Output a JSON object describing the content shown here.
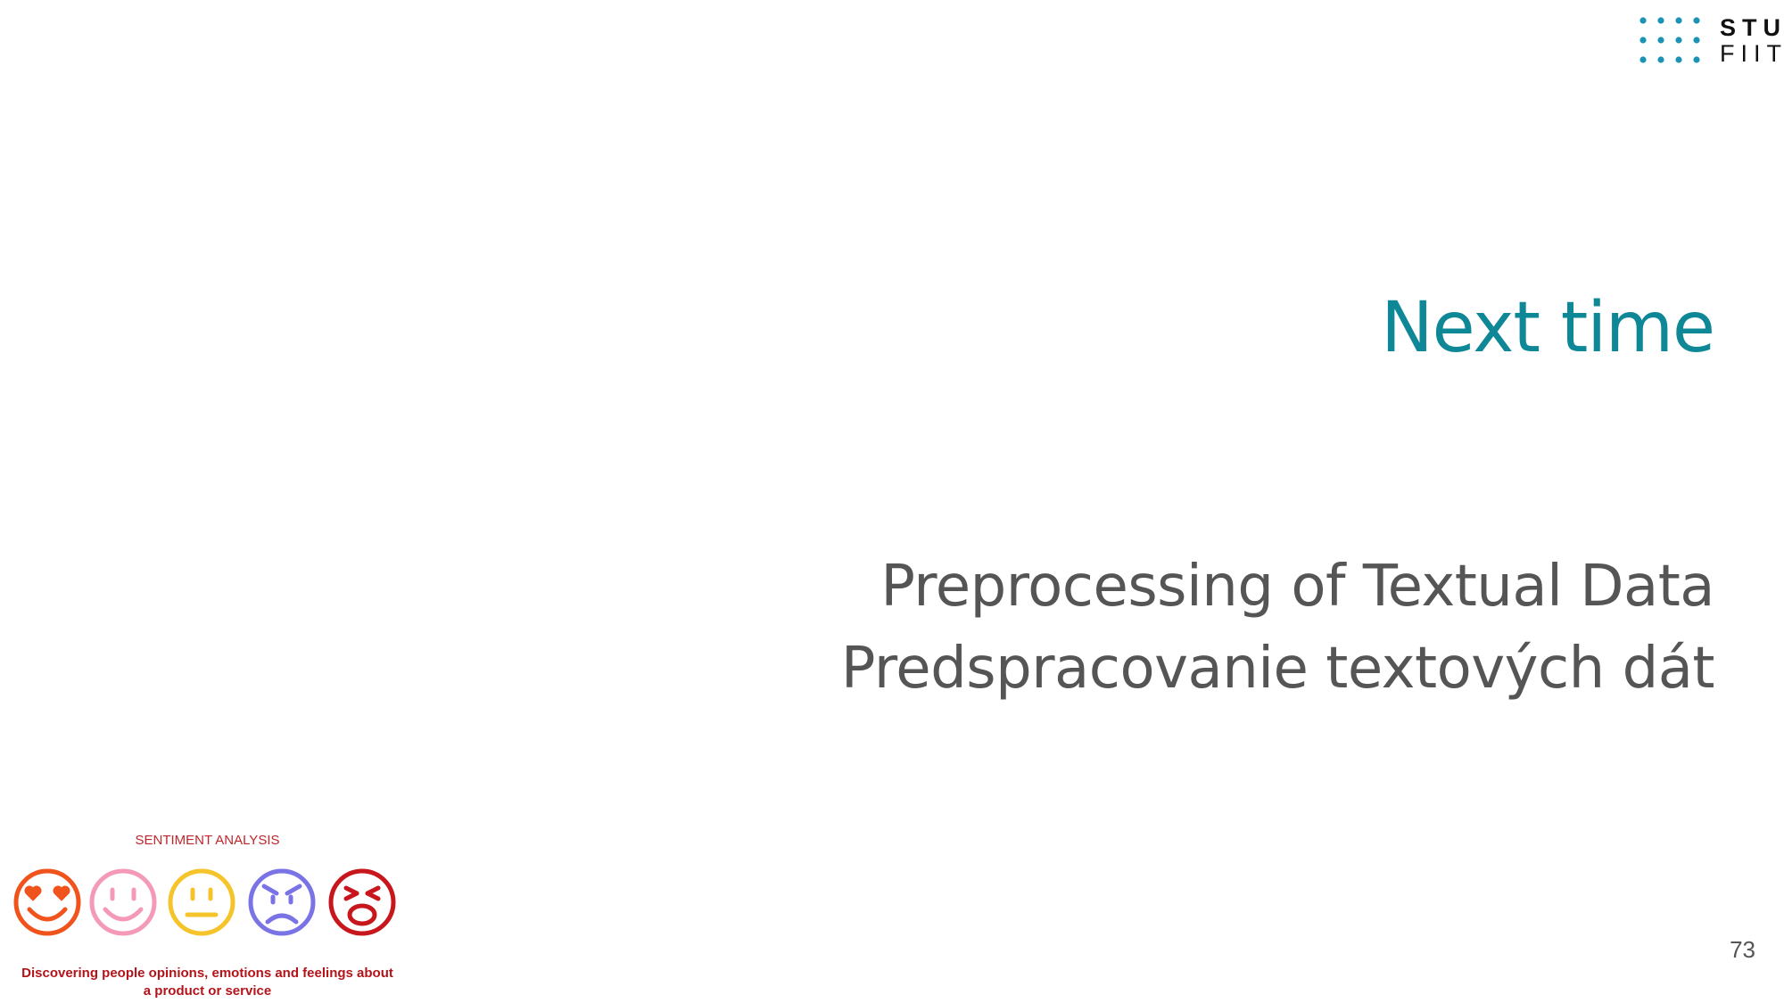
{
  "logo": {
    "line1": "STU",
    "line2": "FIIT",
    "dot_color": "#1a93b5"
  },
  "slide": {
    "title": "Next time",
    "subtitle_en": "Preprocessing of Textual Data",
    "subtitle_sk": "Predspracovanie textových dát",
    "title_color": "#0e8796",
    "text_color": "#555555",
    "page_number": "73"
  },
  "sentiment_image": {
    "caption": "SENTIMENT ANALYSIS",
    "description_line1": "Discovering people opinions, emotions and feelings about",
    "description_line2": "a product or service",
    "faces": [
      {
        "name": "love-face-icon",
        "color": "#f0531c"
      },
      {
        "name": "happy-face-icon",
        "color": "#f49ab8"
      },
      {
        "name": "neutral-face-icon",
        "color": "#f5c42b"
      },
      {
        "name": "sad-face-icon",
        "color": "#7a73e6"
      },
      {
        "name": "angry-face-icon",
        "color": "#c8161d"
      }
    ]
  }
}
